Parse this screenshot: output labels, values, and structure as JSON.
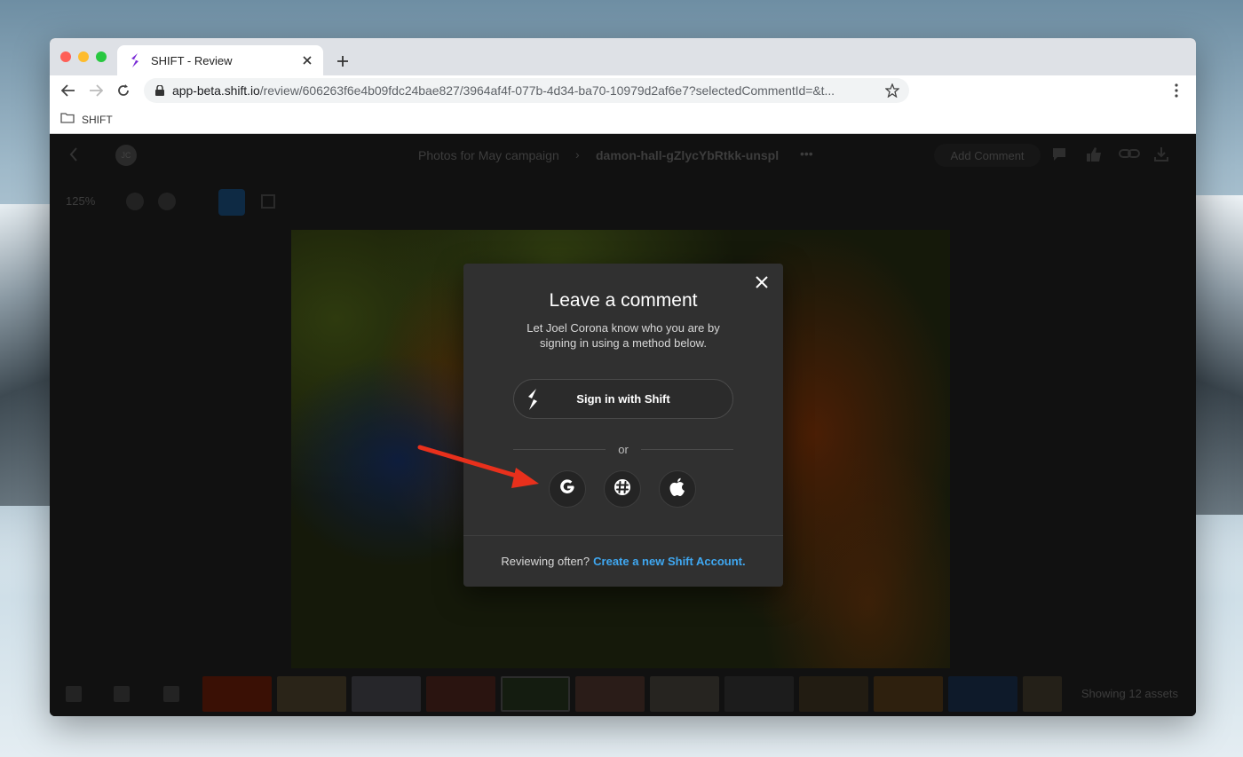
{
  "browser": {
    "tab_title": "SHIFT - Review",
    "url_host": "app-beta.shift.io",
    "url_path": "/review/606263f6e4b09fdc24bae827/3964af4f-077b-4d34-ba70-10979d2af6e7?selectedCommentId=&t...",
    "bookmark_label": "SHIFT"
  },
  "app": {
    "breadcrumb_project": "Photos for May campaign",
    "breadcrumb_separator": "›",
    "breadcrumb_asset": "damon-hall-gZlycYbRtkk-unspl",
    "more": "•••",
    "add_comment": "Add Comment",
    "avatar_initials": "JC",
    "zoom_level": "125%",
    "assets_count": "Showing 12 assets"
  },
  "modal": {
    "title": "Leave a comment",
    "description": "Let Joel Corona know who you are by signing in using a method below.",
    "shift_button": "Sign in with Shift",
    "or_label": "or",
    "footer_text": "Reviewing often?",
    "footer_link": "Create a new Shift Account."
  },
  "colors": {
    "link": "#3fa8f2",
    "brand": "#7a2bd6",
    "annotation_arrow": "#e8301c"
  },
  "icons": [
    "shift-logo-icon",
    "google-icon",
    "slack-icon",
    "apple-icon",
    "close-icon",
    "red-arrow-icon"
  ]
}
